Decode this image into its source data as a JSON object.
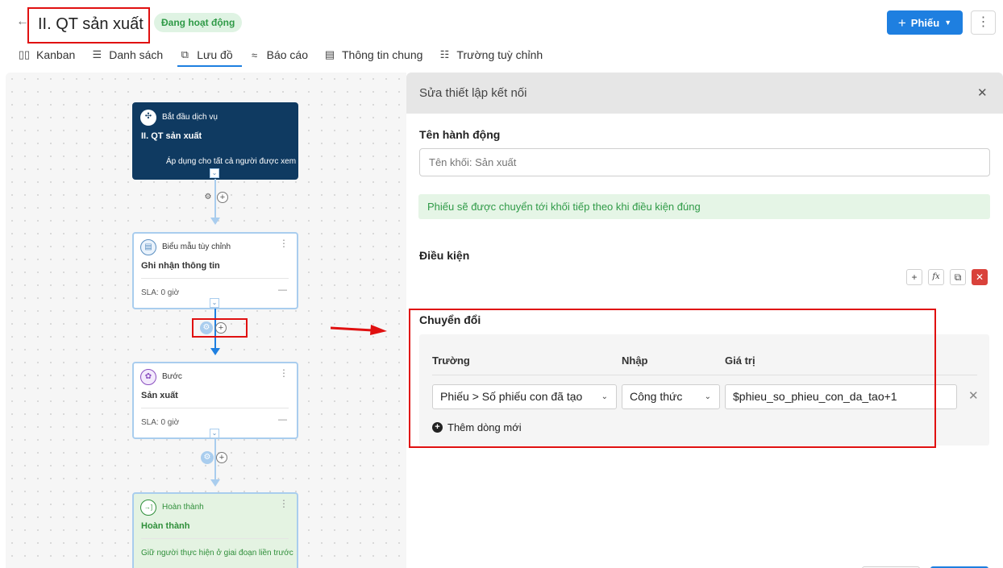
{
  "header": {
    "title": "II. QT sản xuất",
    "status": "Đang hoạt động",
    "primary_button": "Phiếu"
  },
  "tabs": [
    {
      "label": "Kanban",
      "icon": "kanban-icon"
    },
    {
      "label": "Danh sách",
      "icon": "list-icon"
    },
    {
      "label": "Lưu đồ",
      "icon": "flow-icon",
      "active": true
    },
    {
      "label": "Báo cáo",
      "icon": "report-icon"
    },
    {
      "label": "Thông tin chung",
      "icon": "info-icon"
    },
    {
      "label": "Trường tuỳ chỉnh",
      "icon": "custom-fields-icon"
    }
  ],
  "flow": {
    "start": {
      "type": "Bắt đầu dịch vụ",
      "name": "II. QT sản xuất",
      "desc": "Áp dụng cho tất cả người được xem"
    },
    "form": {
      "type": "Biểu mẫu tùy chỉnh",
      "name": "Ghi nhận thông tin",
      "sla": "SLA: 0 giờ"
    },
    "step": {
      "type": "Bước",
      "name": "Sản xuất",
      "sla": "SLA: 0 giờ"
    },
    "done": {
      "type": "Hoàn thành",
      "name": "Hoàn thành",
      "desc": "Giữ người thực hiện ở giai đoạn liền trước"
    }
  },
  "panel": {
    "title": "Sửa thiết lập kết nối",
    "action_label": "Tên hành động",
    "action_placeholder": "Tên khối: Sản xuất",
    "info": "Phiếu sẽ được chuyển tới khối tiếp theo khi điều kiện đúng",
    "condition_label": "Điều kiện",
    "conversion_label": "Chuyển đổi",
    "columns": {
      "field": "Trường",
      "input": "Nhập",
      "value": "Giá trị"
    },
    "row": {
      "field": "Phiếu > Số phiếu con đã tạo",
      "input": "Công thức",
      "value": "$phieu_so_phieu_con_da_tao+1"
    },
    "add_row": "Thêm dòng mới"
  },
  "colors": {
    "accent": "#1e7fe0",
    "highlight": "#e01010",
    "success": "#2f9a47",
    "start_node": "#0f3a61"
  }
}
